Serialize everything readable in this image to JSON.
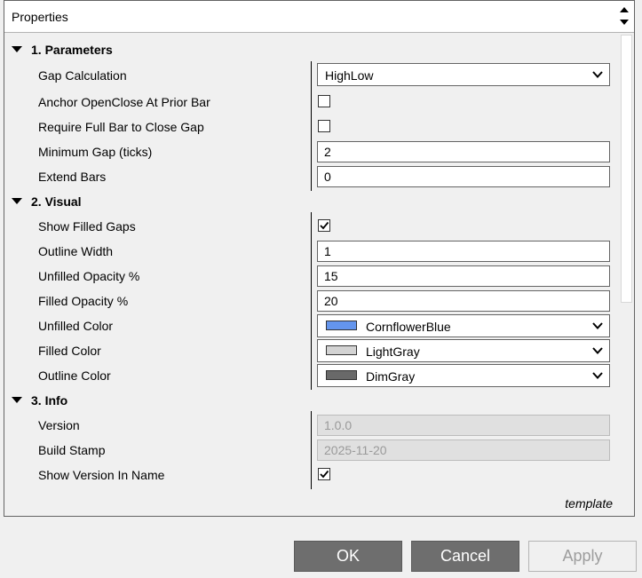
{
  "header": {
    "title": "Properties"
  },
  "sections": [
    {
      "title": "1. Parameters"
    },
    {
      "title": "2. Visual"
    },
    {
      "title": "3. Info"
    }
  ],
  "params": {
    "gap_calculation": {
      "label": "Gap Calculation",
      "value": "HighLow"
    },
    "anchor_openclose": {
      "label": "Anchor OpenClose At Prior Bar",
      "checked": false
    },
    "require_full_bar": {
      "label": "Require Full Bar to Close Gap",
      "checked": false
    },
    "minimum_gap": {
      "label": "Minimum Gap (ticks)",
      "value": "2"
    },
    "extend_bars": {
      "label": "Extend Bars",
      "value": "0"
    }
  },
  "visual": {
    "show_filled_gaps": {
      "label": "Show Filled Gaps",
      "checked": true
    },
    "outline_width": {
      "label": "Outline Width",
      "value": "1"
    },
    "unfilled_opacity": {
      "label": "Unfilled Opacity %",
      "value": "15"
    },
    "filled_opacity": {
      "label": "Filled Opacity %",
      "value": "20"
    },
    "unfilled_color": {
      "label": "Unfilled Color",
      "value": "CornflowerBlue",
      "swatch": "#6495ED"
    },
    "filled_color": {
      "label": "Filled Color",
      "value": "LightGray",
      "swatch": "#D3D3D3"
    },
    "outline_color": {
      "label": "Outline Color",
      "value": "DimGray",
      "swatch": "#696969"
    }
  },
  "info": {
    "version": {
      "label": "Version",
      "value": "1.0.0"
    },
    "build_stamp": {
      "label": "Build Stamp",
      "value": "2025-11-20"
    },
    "show_version": {
      "label": "Show Version In Name",
      "checked": true
    }
  },
  "footer": {
    "template_label": "template"
  },
  "buttons": {
    "ok": "OK",
    "cancel": "Cancel",
    "apply": "Apply"
  }
}
